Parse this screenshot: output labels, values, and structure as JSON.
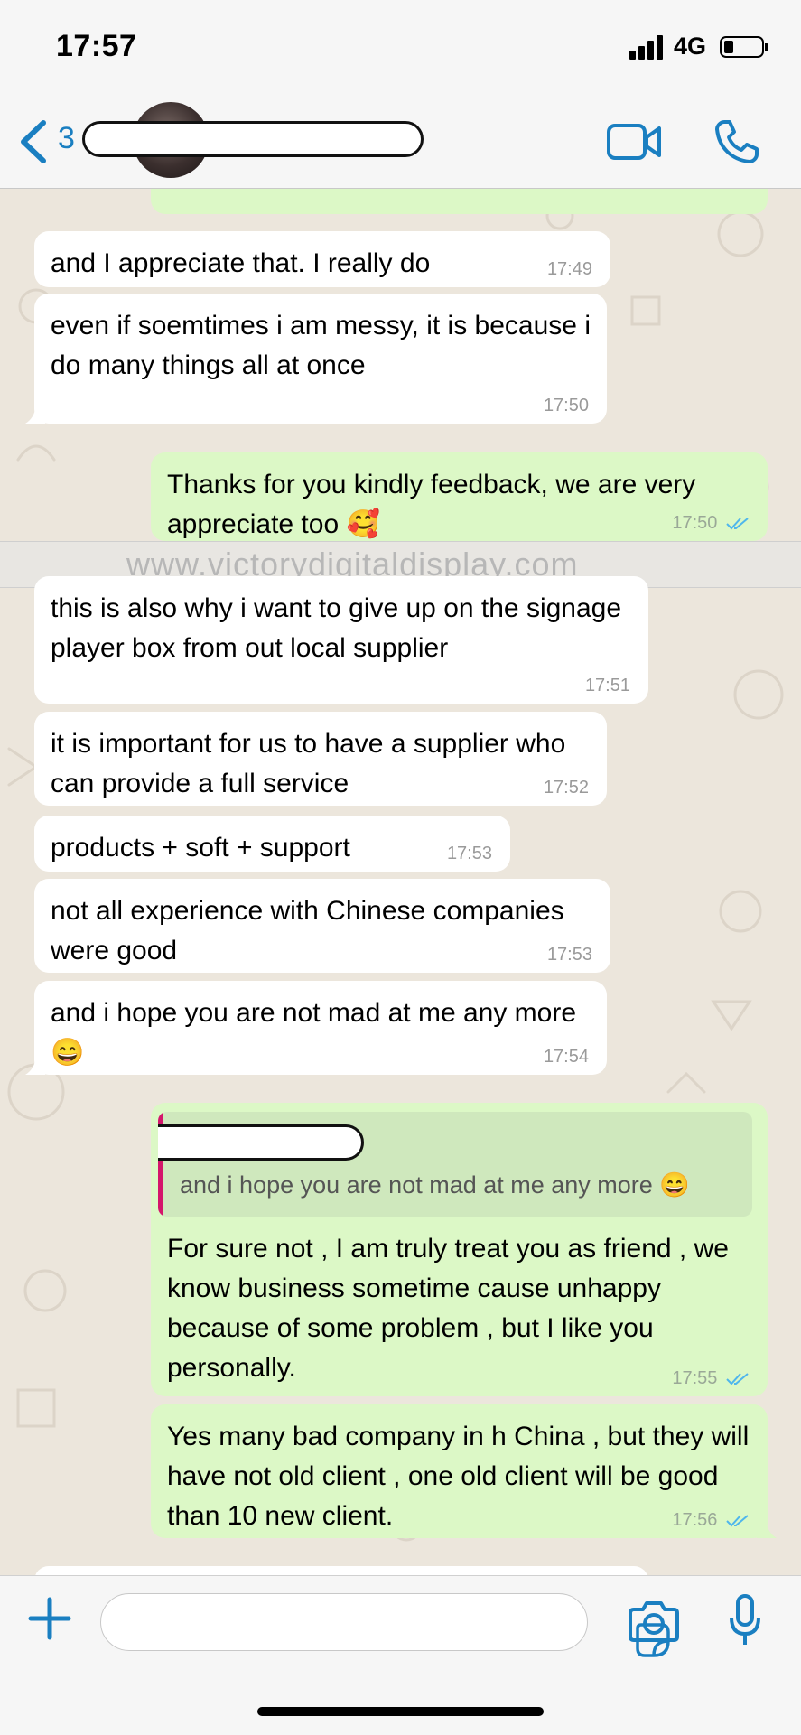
{
  "status_bar": {
    "time": "17:57",
    "network": "4G"
  },
  "header": {
    "unread_count": "3"
  },
  "watermark": "www.victorydigitaldisplay.com",
  "messages": [
    {
      "dir": "out",
      "text": "",
      "time": ""
    },
    {
      "dir": "in",
      "text": "and I appreciate that. I really do",
      "time": "17:49"
    },
    {
      "dir": "in",
      "text": "even if soemtimes i am messy, it is because i do many things all at once",
      "time": "17:50"
    },
    {
      "dir": "out",
      "text": "Thanks for you kindly feedback, we are very appreciate too 🥰",
      "time": "17:50"
    },
    {
      "dir": "in",
      "text": "this is also why i want to give up on the signage player box from out local supplier",
      "time": "17:51"
    },
    {
      "dir": "in",
      "text": "it is important for us to have a supplier who can provide a full service",
      "time": "17:52"
    },
    {
      "dir": "in",
      "text": "products + soft + support",
      "time": "17:53"
    },
    {
      "dir": "in",
      "text": "not all experience with Chinese companies were good",
      "time": "17:53"
    },
    {
      "dir": "in",
      "text": "and i hope you are not mad at me any more 😄",
      "time": "17:54"
    },
    {
      "dir": "out",
      "quote": "and i hope you are not mad at me any more 😄",
      "text": "For sure not , I am truly treat you as friend , we know business sometime cause unhappy because of some problem , but I like you personally.",
      "time": "17:55"
    },
    {
      "dir": "out",
      "text": "Yes many bad company in h China , but they will have not old client , one old client will be good than 10 new client.",
      "time": "17:56"
    }
  ],
  "icons": {
    "back": "chevron-left-icon",
    "video": "video-camera-icon",
    "call": "phone-icon",
    "plus": "plus-icon",
    "sticker": "sticker-icon",
    "camera": "camera-icon",
    "mic": "microphone-icon"
  },
  "colors": {
    "accent": "#1a7fc1",
    "outgoing": "#dcf8c6",
    "incoming": "#ffffff",
    "read_ticks": "#4fb6ec",
    "quote_bar": "#d4166b"
  }
}
